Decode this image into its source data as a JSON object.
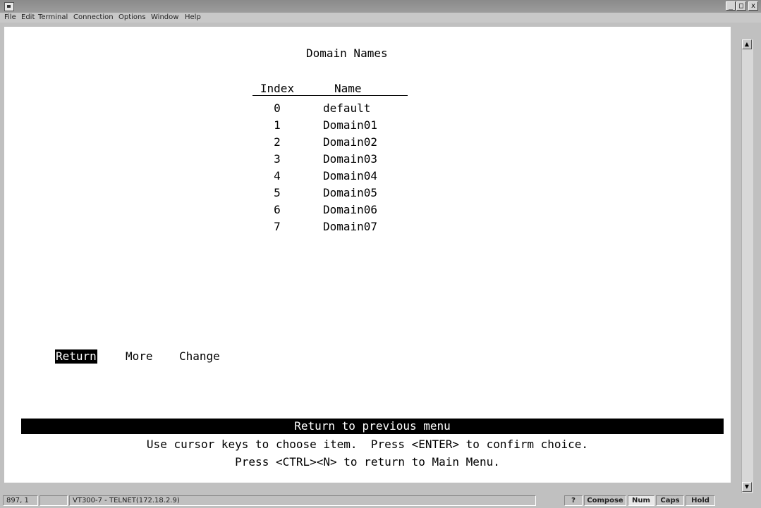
{
  "window": {
    "controls": [
      "_",
      "□",
      "x"
    ]
  },
  "menu": [
    "File",
    "Edit",
    "Terminal",
    "Connection",
    "Options",
    "Window",
    "Help"
  ],
  "screen": {
    "title": "Domain Names",
    "columns": {
      "index": "Index",
      "name": "Name"
    },
    "rows": [
      {
        "index": "0",
        "name": "default"
      },
      {
        "index": "1",
        "name": "Domain01"
      },
      {
        "index": "2",
        "name": "Domain02"
      },
      {
        "index": "3",
        "name": "Domain03"
      },
      {
        "index": "4",
        "name": "Domain04"
      },
      {
        "index": "5",
        "name": "Domain05"
      },
      {
        "index": "6",
        "name": "Domain06"
      },
      {
        "index": "7",
        "name": "Domain07"
      }
    ],
    "actions": {
      "return": "Return",
      "more": "More",
      "change": "Change"
    },
    "message": "Return to previous menu",
    "help1": "Use cursor keys to choose item.  Press <ENTER> to confirm choice.",
    "help2": "Press <CTRL><N> to return to Main Menu."
  },
  "status": {
    "position": "897, 1",
    "session": "VT300-7 - TELNET(172.18.2.9)",
    "help": "?",
    "compose": "Compose",
    "num": "Num",
    "caps": "Caps",
    "hold": "Hold"
  }
}
